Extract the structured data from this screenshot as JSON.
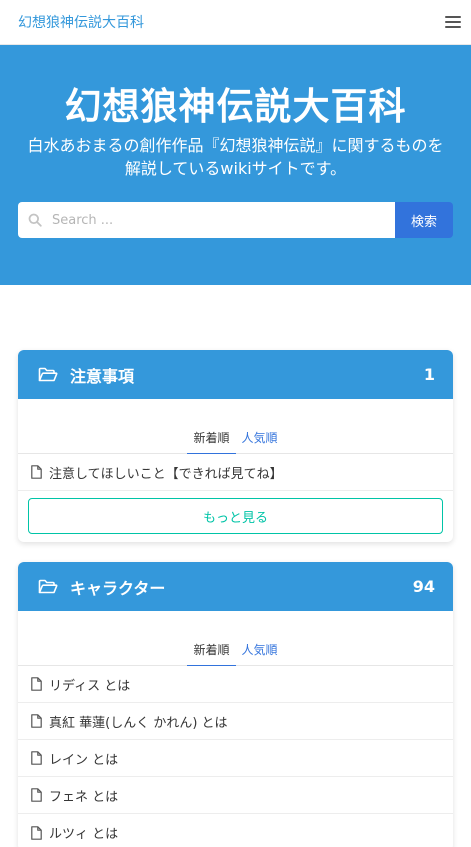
{
  "navbar": {
    "brand": "幻想狼神伝説大百科"
  },
  "hero": {
    "title": "幻想狼神伝説大百科",
    "subtitle": "白水あおまるの創作作品『幻想狼神伝説』に関するものを解説しているwikiサイトです。"
  },
  "search": {
    "placeholder": "Search ...",
    "button_label": "検索"
  },
  "sections": [
    {
      "title": "注意事項",
      "count": "1",
      "tabs": [
        "新着順",
        "人気順"
      ],
      "items": [
        "注意してほしいこと【できれば見てね】"
      ],
      "more_label": "もっと見る"
    },
    {
      "title": "キャラクター",
      "count": "94",
      "tabs": [
        "新着順",
        "人気順"
      ],
      "items": [
        "リディス とは",
        "真紅 華蓮(しんく かれん) とは",
        "レイン とは",
        "フェネ とは",
        "ルツィ とは"
      ]
    }
  ]
}
